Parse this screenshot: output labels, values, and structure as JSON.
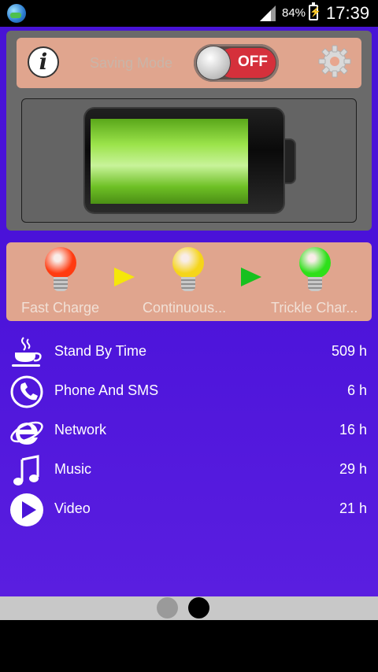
{
  "status_bar": {
    "battery_percent": "84%",
    "time": "17:39",
    "icons": [
      "app-globe-icon",
      "signal-icon",
      "battery-charging-icon"
    ]
  },
  "saving_mode": {
    "label": "Saving Mode",
    "toggle_text": "OFF",
    "toggle_state": "off",
    "info_icon": "i"
  },
  "battery": {
    "level_fraction": 0.84,
    "fill_color": "#8fdc3c"
  },
  "charge_stages": [
    {
      "label": "Fast Charge",
      "color": "#ff3b10"
    },
    {
      "label": "Continuous...",
      "color": "#f5d51a"
    },
    {
      "label": "Trickle Char...",
      "color": "#2ee01a"
    }
  ],
  "stage_arrows": [
    {
      "color": "#f5e60a"
    },
    {
      "color": "#17c11f"
    }
  ],
  "usage": [
    {
      "icon": "coffee-cup-icon",
      "label": "Stand By Time",
      "value": "509 h"
    },
    {
      "icon": "phone-icon",
      "label": "Phone And SMS",
      "value": "6 h"
    },
    {
      "icon": "internet-explorer-icon",
      "label": "Network",
      "value": "16 h"
    },
    {
      "icon": "music-note-icon",
      "label": "Music",
      "value": "29 h"
    },
    {
      "icon": "play-icon",
      "label": "Video",
      "value": "21 h"
    }
  ],
  "pager": {
    "page_count": 2,
    "current_page": 2,
    "active_color": "#000000",
    "inactive_color": "#9a9a9a"
  }
}
